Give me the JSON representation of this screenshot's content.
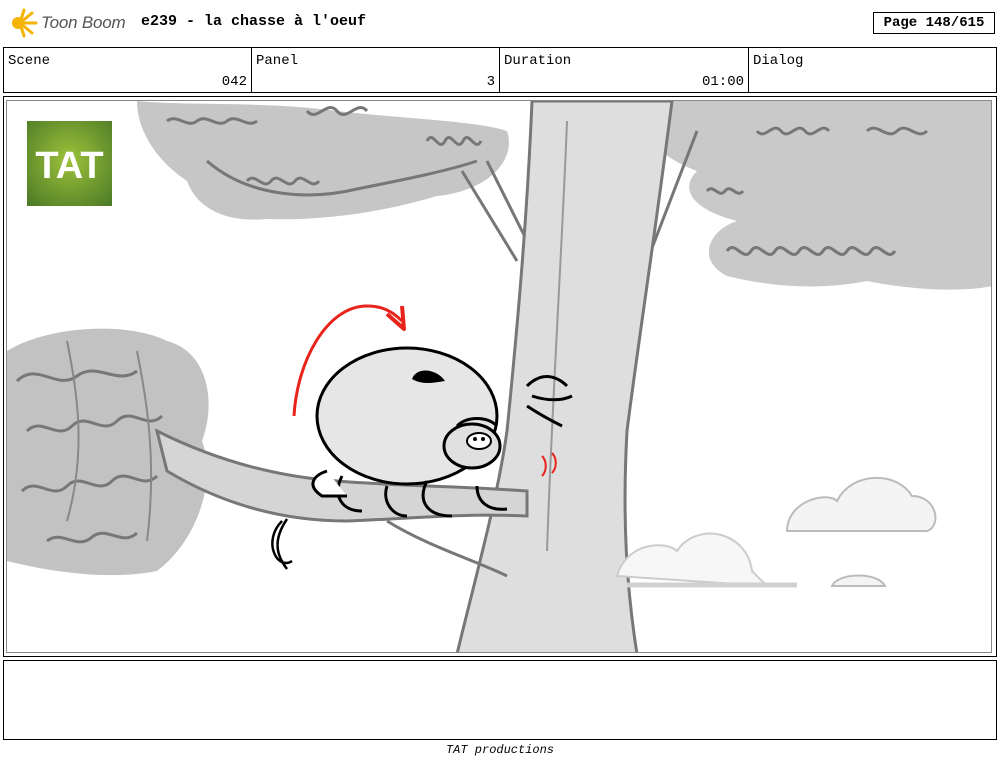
{
  "header": {
    "app_name": "Toon Boom",
    "title": "e239 - la chasse à l'oeuf",
    "page": "Page 148/615"
  },
  "info": {
    "scene": {
      "label": "Scene",
      "value": "042"
    },
    "panel": {
      "label": "Panel",
      "value": "3"
    },
    "duration": {
      "label": "Duration",
      "value": "01:00"
    },
    "dialog": {
      "label": "Dialog",
      "value": ""
    }
  },
  "panel_image": {
    "badge": "TAT",
    "badge_color": "#6c9a2c",
    "motion_arrow_color": "#e8231b"
  },
  "footer": "TAT productions"
}
